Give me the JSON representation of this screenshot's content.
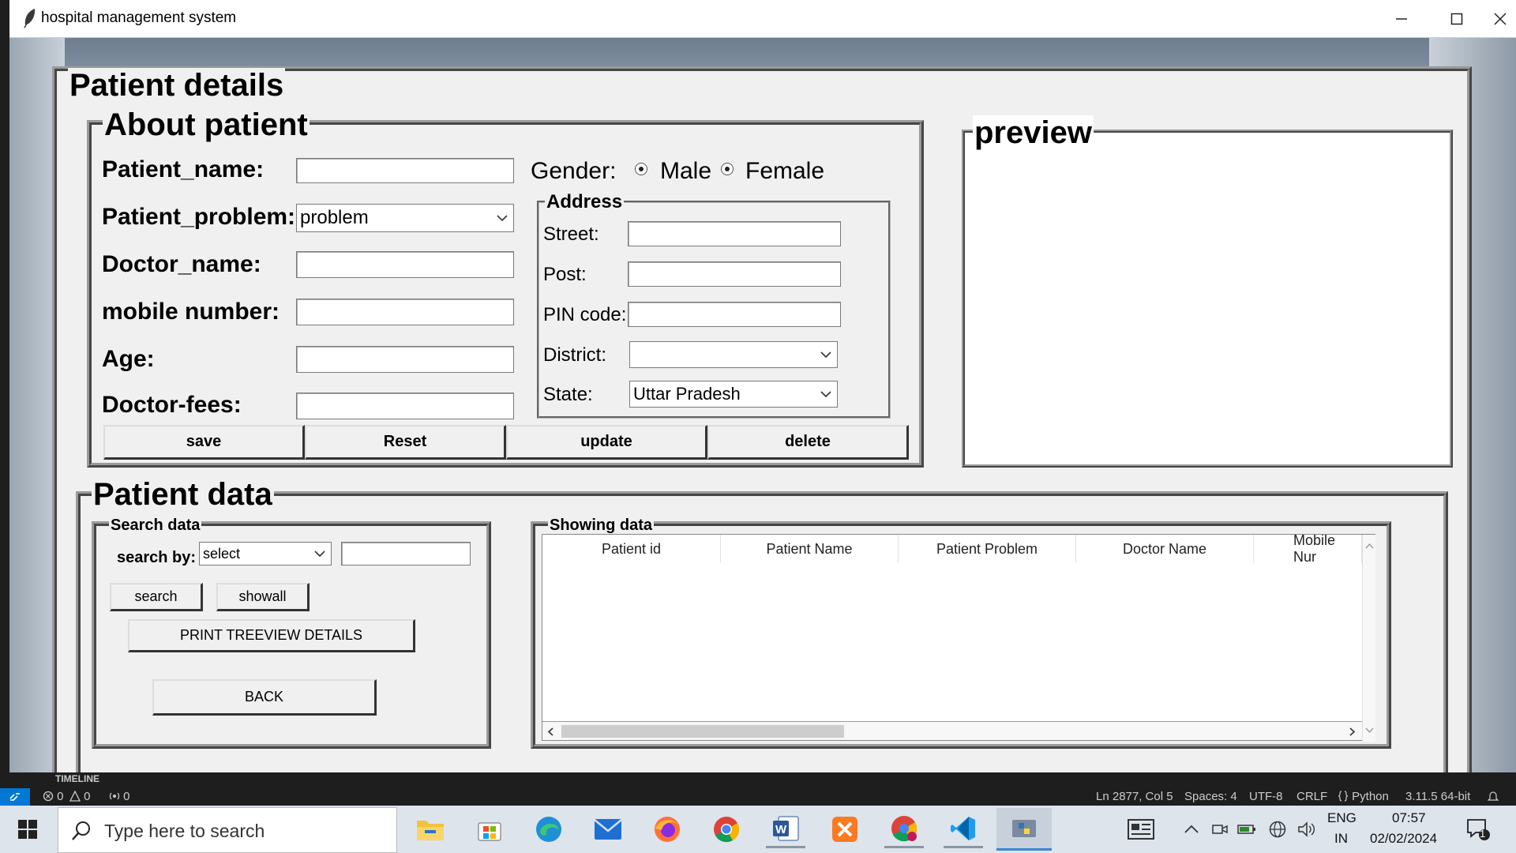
{
  "window": {
    "title": "hospital management system"
  },
  "main": {
    "title": "Patient details"
  },
  "about": {
    "title": "About patient",
    "labels": {
      "patient_name": "Patient_name:",
      "patient_problem": "Patient_problem:",
      "doctor_name": "Doctor_name:",
      "mobile": "mobile number:",
      "age": "Age:",
      "fees": "Doctor-fees:"
    },
    "problem_value": "problem",
    "gender_label": "Gender:",
    "gender_options": [
      "Male",
      "Female"
    ],
    "address": {
      "title": "Address",
      "street": "Street:",
      "post": "Post:",
      "pin": "PIN code:",
      "district": "District:",
      "state": "State:",
      "district_value": "",
      "state_value": "Uttar Pradesh"
    },
    "buttons": {
      "save": "save",
      "reset": "Reset",
      "update": "update",
      "delete": "delete"
    }
  },
  "preview": {
    "title": "preview"
  },
  "patient_data": {
    "title": "Patient data",
    "search": {
      "title": "Search data",
      "by_label": "search by:",
      "select_value": "select",
      "search_btn": "search",
      "showall_btn": "showall",
      "print_btn": "PRINT TREEVIEW DETAILS",
      "back_btn": "BACK"
    },
    "showing": {
      "title": "Showing data",
      "columns": [
        "Patient id",
        "Patient Name",
        "Patient Problem",
        "Doctor Name",
        "Mobile Nur"
      ]
    }
  },
  "vscode": {
    "timeline": "TIMELINE",
    "errors": "0",
    "warnings": "0",
    "ports": "0",
    "position": "Ln 2877, Col 5",
    "spaces": "Spaces: 4",
    "encoding": "UTF-8",
    "eol": "CRLF",
    "language": "Python",
    "interpreter": "3.11.5 64-bit"
  },
  "taskbar": {
    "search_placeholder": "Type here to search",
    "apps": [
      "file-explorer",
      "microsoft-store",
      "edge",
      "mail",
      "firefox",
      "chrome",
      "word",
      "xampp",
      "chrome-profile",
      "vscode",
      "python"
    ],
    "lang_top": "ENG",
    "lang_bottom": "IN",
    "time": "07:57",
    "date": "02/02/2024",
    "notifications": "1"
  },
  "colors": {
    "accent": "#0078d4",
    "panel": "#f0f0f0",
    "taskbar": "#dde4ec"
  }
}
